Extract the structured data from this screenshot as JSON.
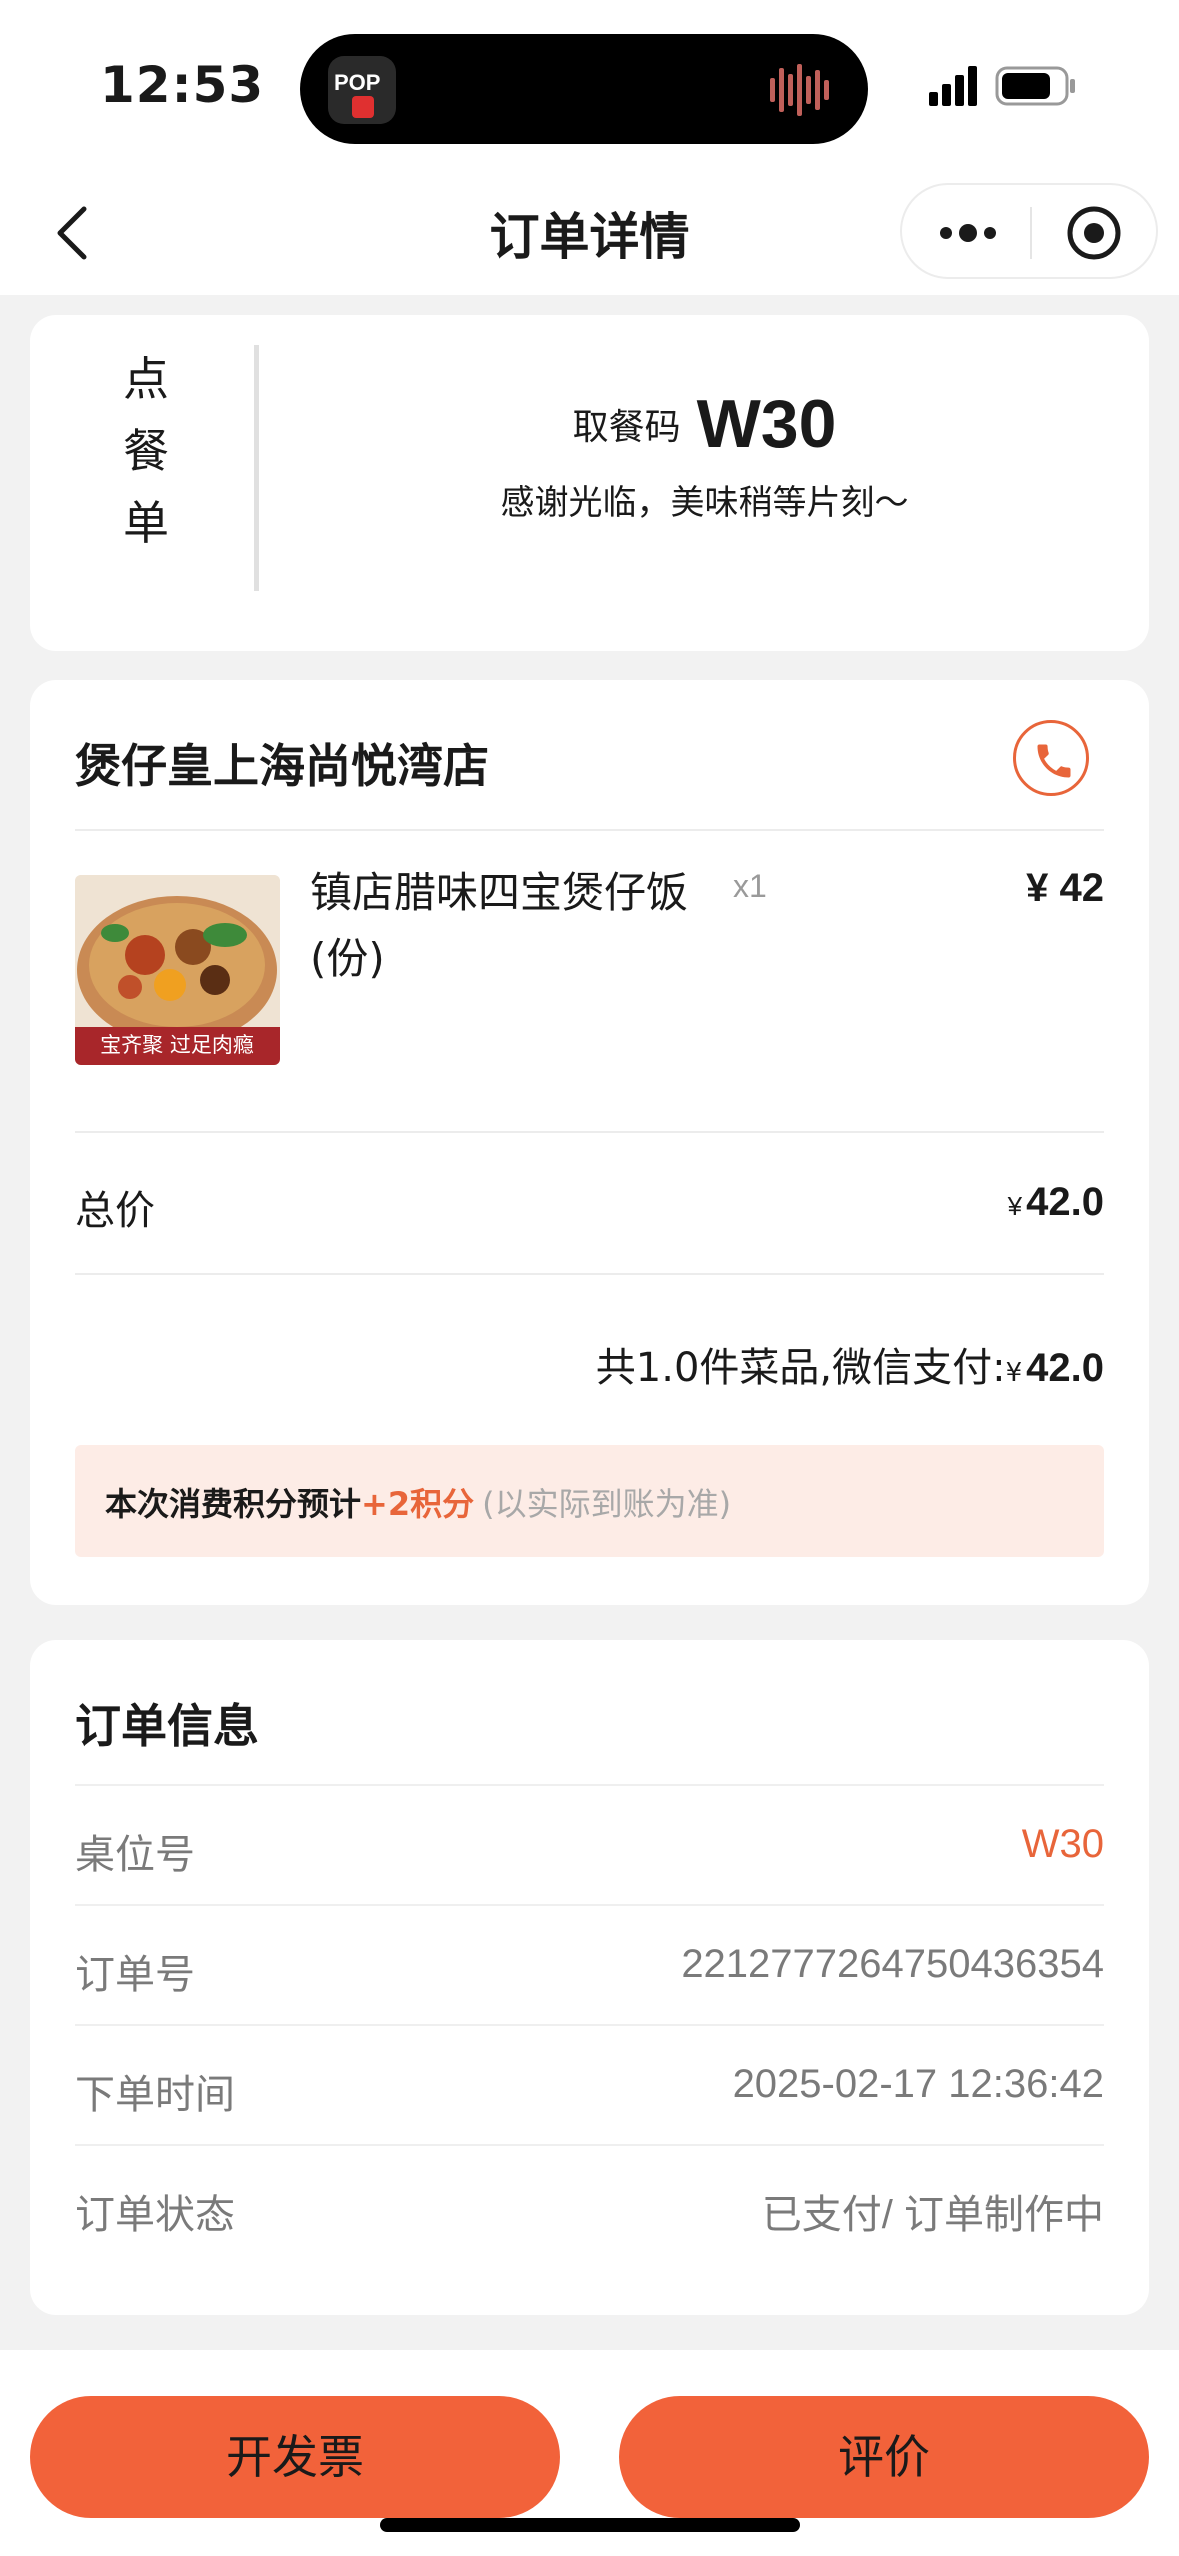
{
  "status_bar": {
    "time": "12:53",
    "island_app_text": "POP"
  },
  "nav": {
    "title": "订单详情"
  },
  "pickup": {
    "vertical_label": [
      "点",
      "餐",
      "单"
    ],
    "code_label": "取餐码",
    "code": "W30",
    "message": "感谢光临，美味稍等片刻～"
  },
  "order": {
    "store_name": "煲仔皇上海尚悦湾店",
    "item": {
      "name": "镇店腊味四宝煲仔饭(份)",
      "qty": "x1",
      "price": "¥ 42",
      "image_caption": "宝齐聚  过足肉瘾"
    },
    "total_label": "总价",
    "total_yen": "¥",
    "total_value": "42.0",
    "summary_prefix": "共1.0件菜品,微信支付:",
    "summary_yen": "¥",
    "summary_amount": "42.0",
    "points_prefix": "本次消费积分预计",
    "points_value": "+2积分",
    "points_note": "(以实际到账为准)"
  },
  "info": {
    "title": "订单信息",
    "rows": [
      {
        "key": "桌位号",
        "value": "W30"
      },
      {
        "key": "订单号",
        "value": "2212777264750436354"
      },
      {
        "key": "下单时间",
        "value": "2025-02-17 12:36:42"
      },
      {
        "key": "订单状态",
        "value": "已支付/ 订单制作中"
      }
    ]
  },
  "actions": {
    "invoice": "开发票",
    "review": "评价"
  },
  "colors": {
    "accent": "#f2623a",
    "accent_text": "#e8653a",
    "points_bg": "#fdece6"
  }
}
